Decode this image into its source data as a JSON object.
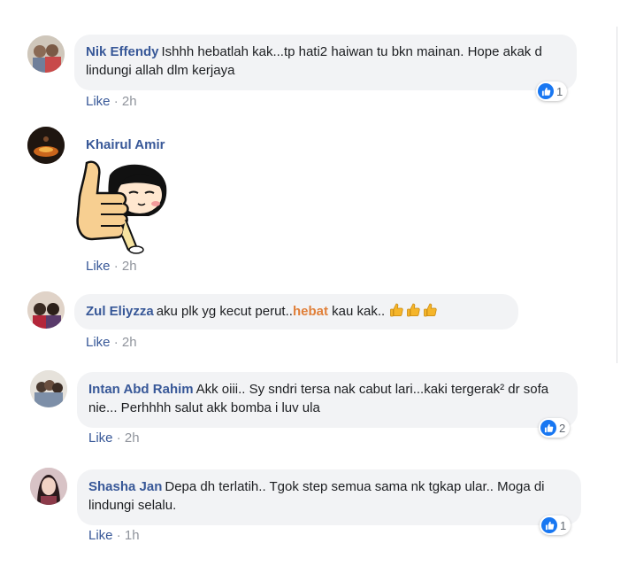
{
  "comments": [
    {
      "author": "Nik Effendy",
      "text": "Ishhh hebatlah kak...tp hati2 haiwan tu bkn mainan. Hope akak d lindungi allah dlm kerjaya",
      "like": "Like",
      "time": "2h",
      "reactions": "1"
    },
    {
      "author": "Khairul Amir",
      "sticker": "thumbs-up-girl-sticker",
      "like": "Like",
      "time": "2h"
    },
    {
      "author": "Zul Eliyzza",
      "text_before": "aku plk yg kecut perut..",
      "text_highlight": "hebat",
      "text_after": " kau kak..",
      "emoji": "thumbs-up-emoji",
      "like": "Like",
      "time": "2h"
    },
    {
      "author": "Intan Abd Rahim",
      "text": "Akk oiii.. Sy sndri tersa nak cabut lari...kaki tergerak² dr sofa nie... Perhhhh salut akk bomba i luv ula",
      "like": "Like",
      "time": "2h",
      "reactions": "2"
    },
    {
      "author": "Shasha Jan",
      "text": "Depa dh terlatih.. Tgok step semua sama nk tgkap ular.. Moga di lindungi selalu.",
      "like": "Like",
      "time": "1h",
      "reactions": "1"
    }
  ],
  "sep": " · ",
  "colors": {
    "link": "#385898",
    "bubble": "#f2f3f5",
    "like_blue": "#1877f2",
    "highlight": "#e0803a"
  }
}
